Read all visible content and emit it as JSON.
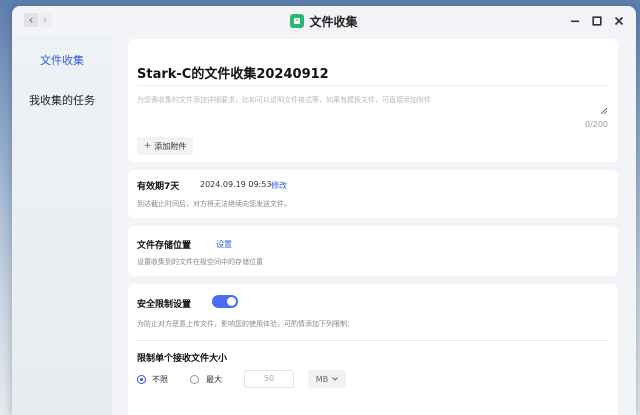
{
  "window": {
    "title": "文件收集"
  },
  "sidebar": {
    "items": [
      {
        "label": "文件收集",
        "active": true
      },
      {
        "label": "我收集的任务",
        "active": false
      }
    ]
  },
  "collection": {
    "title": "Stark-C的文件收集20240912",
    "description_placeholder": "为您需收集的文件添加详细要求，比如可以说明文件格式等，如果有模板文件，可直接添加附件",
    "char_counter": "0/200",
    "add_attachment_label": "添加附件"
  },
  "validity": {
    "label": "有效期7天",
    "date": "2024.09.19 09:53",
    "edit_label": "修改",
    "note": "到达截止时间后，对方将无法继续向您发送文件。"
  },
  "storage": {
    "label": "文件存储位置",
    "set_label": "设置",
    "note": "设置收集到的文件在极空间中的存储位置"
  },
  "security": {
    "label": "安全限制设置",
    "enabled": true,
    "note": "为防止对方恶意上传文件，影响您的使用体验，可酌情添加下列限制：",
    "size_limit": {
      "label": "限制单个接收文件大小",
      "options": [
        "不限",
        "最大"
      ],
      "selected": "不限",
      "value_placeholder": "50",
      "unit": "MB"
    }
  },
  "colors": {
    "accent": "#2d5be3",
    "toggle": "#4a6cf0",
    "app_icon": "#2bb673"
  },
  "icons": {
    "back": "chevron-left-icon",
    "forward": "chevron-right-icon",
    "app": "app-logo-icon",
    "minimize": "minimize-icon",
    "maximize": "maximize-icon",
    "close": "close-icon",
    "plus": "plus-icon",
    "dropdown": "chevron-down-icon"
  }
}
